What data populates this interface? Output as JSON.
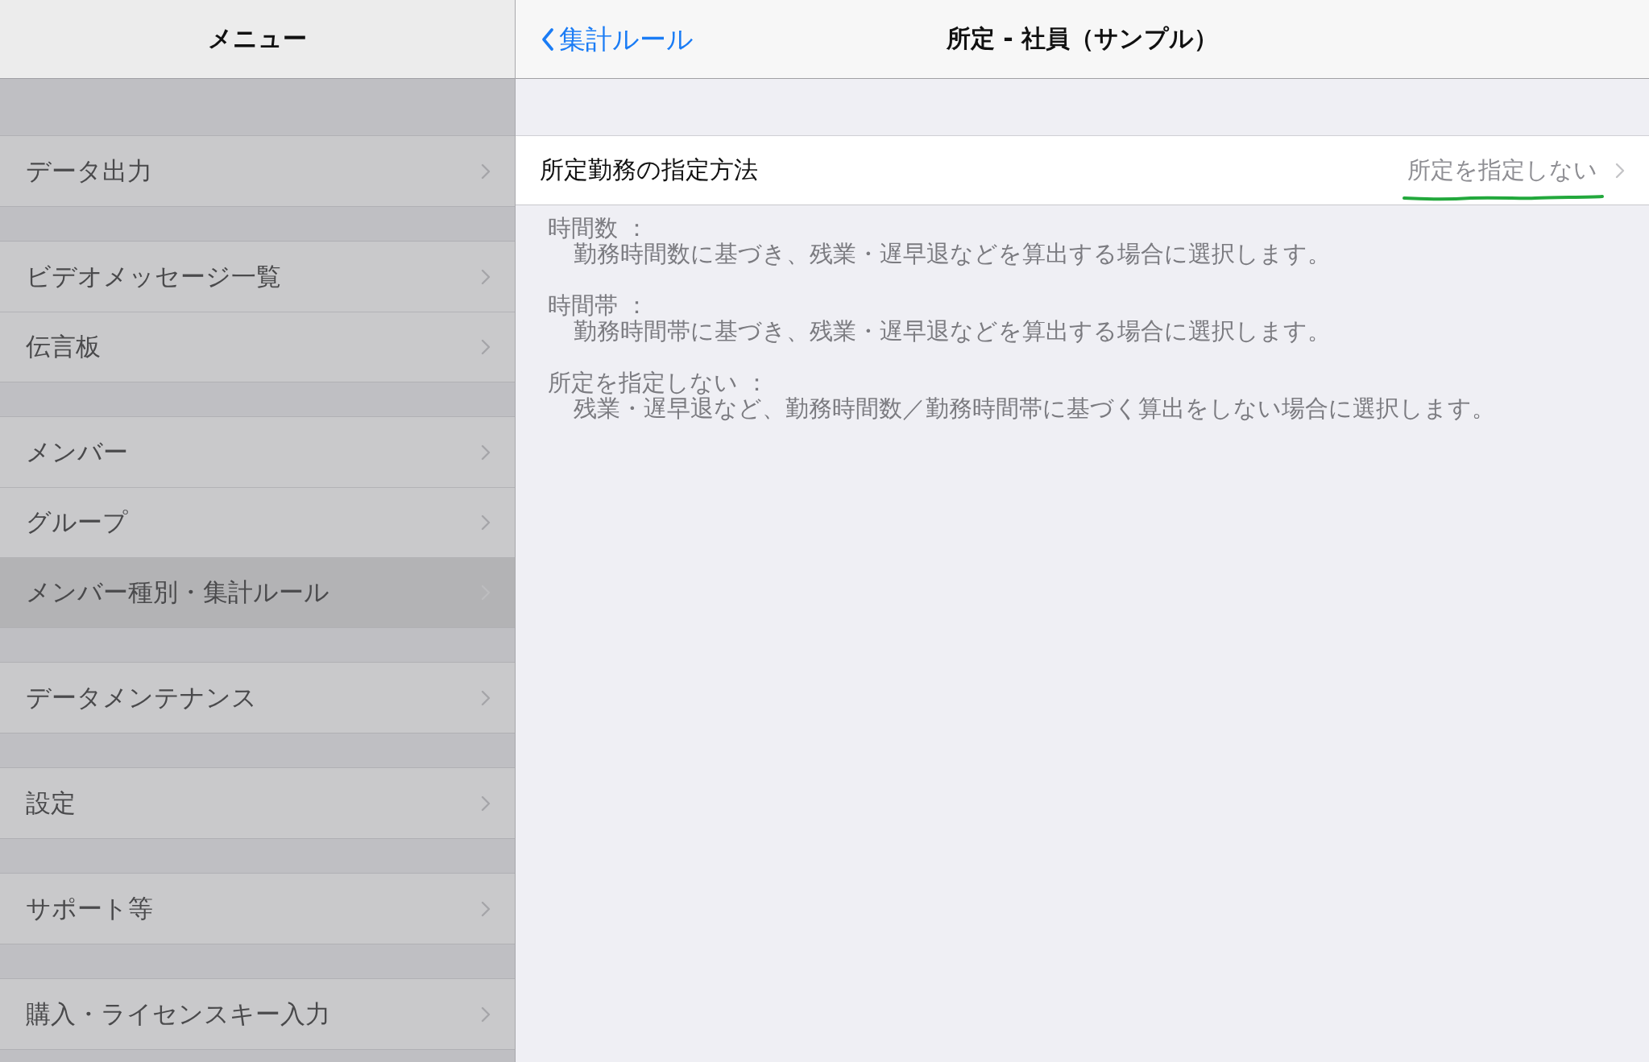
{
  "sidebar": {
    "title": "メニュー",
    "sections": [
      {
        "items": [
          {
            "label": "データ出力",
            "selected": false
          }
        ]
      },
      {
        "items": [
          {
            "label": "ビデオメッセージ一覧",
            "selected": false
          },
          {
            "label": "伝言板",
            "selected": false
          }
        ]
      },
      {
        "items": [
          {
            "label": "メンバー",
            "selected": false
          },
          {
            "label": "グループ",
            "selected": false
          },
          {
            "label": "メンバー種別・集計ルール",
            "selected": true
          }
        ]
      },
      {
        "items": [
          {
            "label": "データメンテナンス",
            "selected": false
          }
        ]
      },
      {
        "items": [
          {
            "label": "設定",
            "selected": false
          }
        ]
      },
      {
        "items": [
          {
            "label": "サポート等",
            "selected": false
          }
        ]
      },
      {
        "items": [
          {
            "label": "購入・ライセンスキー入力",
            "selected": false
          }
        ]
      }
    ]
  },
  "detail": {
    "back_label": "集計ルール",
    "title": "所定 - 社員（サンプル）",
    "setting": {
      "label": "所定勤務の指定方法",
      "value": "所定を指定しない"
    },
    "notes": [
      {
        "term": "時間数 ：",
        "description": "勤務時間数に基づき、残業・遅早退などを算出する場合に選択します。"
      },
      {
        "term": "時間帯 ：",
        "description": "勤務時間帯に基づき、残業・遅早退などを算出する場合に選択します。"
      },
      {
        "term": "所定を指定しない ：",
        "description": "残業・遅早退など、勤務時間数／勤務時間帯に基づく算出をしない場合に選択します。"
      }
    ]
  }
}
